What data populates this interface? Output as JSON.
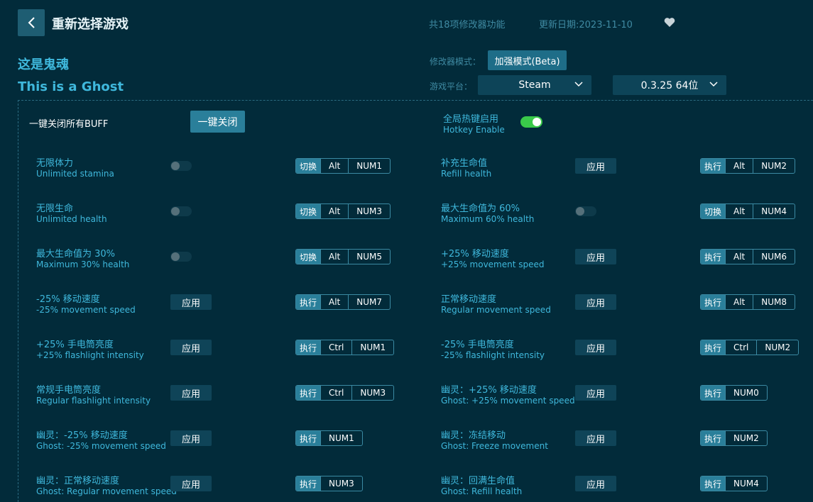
{
  "header": {
    "title": "重新选择游戏",
    "feature_count": "共18项修改器功能",
    "update_date": "更新日期:2023-11-10"
  },
  "game": {
    "name_cn": "这是鬼魂",
    "name_en": "This is a Ghost"
  },
  "settings": {
    "mode_label": "修改器模式：",
    "mode_value": "加强模式(Beta)",
    "platform_label": "游戏平台：",
    "platform_value": "Steam",
    "version_value": "0.3.25 64位"
  },
  "controls": {
    "all_off_label": "一键关闭所有BUFF",
    "all_off_button": "一键关闭",
    "hotkey_enable_cn": "全局热键启用",
    "hotkey_enable_en": "Hotkey Enable",
    "hotkey_enabled": true
  },
  "colors": {
    "background": "#022b3a",
    "accent": "#3fb8dc",
    "toggle_on": "#3ac94a"
  },
  "left_items": [
    {
      "cn": "无限体力",
      "en": "Unlimited stamina",
      "control": "toggle",
      "action": "切换",
      "keys": [
        "Alt",
        "NUM1"
      ]
    },
    {
      "cn": "无限生命",
      "en": "Unlimited health",
      "control": "toggle",
      "action": "切换",
      "keys": [
        "Alt",
        "NUM3"
      ]
    },
    {
      "cn": "最大生命值为 30%",
      "en": "Maximum 30% health",
      "control": "toggle",
      "action": "切换",
      "keys": [
        "Alt",
        "NUM5"
      ]
    },
    {
      "cn": "-25% 移动速度",
      "en": "-25% movement speed",
      "control": "apply",
      "apply_label": "应用",
      "action": "执行",
      "keys": [
        "Alt",
        "NUM7"
      ]
    },
    {
      "cn": "+25% 手电筒亮度",
      "en": "+25% flashlight intensity",
      "control": "apply",
      "apply_label": "应用",
      "action": "执行",
      "keys": [
        "Ctrl",
        "NUM1"
      ]
    },
    {
      "cn": "常规手电筒亮度",
      "en": "Regular flashlight intensity",
      "control": "apply",
      "apply_label": "应用",
      "action": "执行",
      "keys": [
        "Ctrl",
        "NUM3"
      ]
    },
    {
      "cn": "幽灵：-25% 移动速度",
      "en": "Ghost: -25% movement speed",
      "control": "apply",
      "apply_label": "应用",
      "action": "执行",
      "keys": [
        "NUM1"
      ]
    },
    {
      "cn": "幽灵：正常移动速度",
      "en": "Ghost: Regular movement speed",
      "control": "apply",
      "apply_label": "应用",
      "action": "执行",
      "keys": [
        "NUM3"
      ]
    }
  ],
  "right_items": [
    {
      "cn": "补充生命值",
      "en": "Refill health",
      "control": "apply",
      "apply_label": "应用",
      "action": "执行",
      "keys": [
        "Alt",
        "NUM2"
      ]
    },
    {
      "cn": "最大生命值为 60%",
      "en": "Maximum 60% health",
      "control": "toggle",
      "action": "切换",
      "keys": [
        "Alt",
        "NUM4"
      ]
    },
    {
      "cn": "+25% 移动速度",
      "en": "+25% movement speed",
      "control": "apply",
      "apply_label": "应用",
      "action": "执行",
      "keys": [
        "Alt",
        "NUM6"
      ]
    },
    {
      "cn": "正常移动速度",
      "en": "Regular movement speed",
      "control": "apply",
      "apply_label": "应用",
      "action": "执行",
      "keys": [
        "Alt",
        "NUM8"
      ]
    },
    {
      "cn": "-25% 手电筒亮度",
      "en": "-25% flashlight intensity",
      "control": "apply",
      "apply_label": "应用",
      "action": "执行",
      "keys": [
        "Ctrl",
        "NUM2"
      ]
    },
    {
      "cn": "幽灵：+25% 移动速度",
      "en": "Ghost: +25% movement speed",
      "control": "apply",
      "apply_label": "应用",
      "action": "执行",
      "keys": [
        "NUM0"
      ]
    },
    {
      "cn": "幽灵：冻结移动",
      "en": "Ghost: Freeze movement",
      "control": "apply",
      "apply_label": "应用",
      "action": "执行",
      "keys": [
        "NUM2"
      ]
    },
    {
      "cn": "幽灵：回满生命值",
      "en": "Ghost: Refill health",
      "control": "apply",
      "apply_label": "应用",
      "action": "执行",
      "keys": [
        "NUM4"
      ]
    }
  ]
}
